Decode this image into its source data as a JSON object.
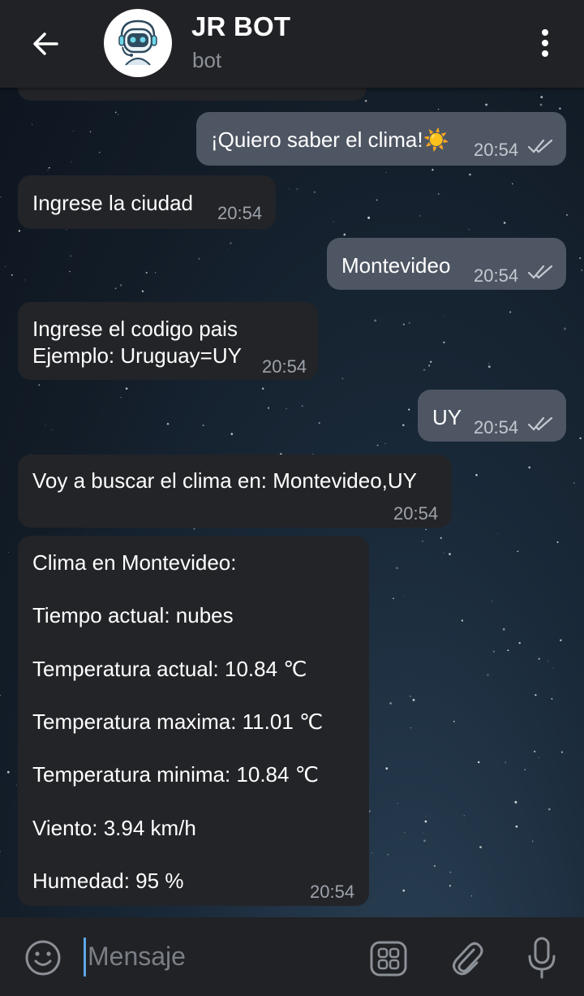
{
  "header": {
    "title": "JR BOT",
    "subtitle": "bot"
  },
  "messages": [
    {
      "id": "m1",
      "side": "out",
      "text": "¡Quiero saber el clima!☀️",
      "time": "20:54",
      "read": true
    },
    {
      "id": "m2",
      "side": "in",
      "text": "Ingrese la ciudad",
      "time": "20:54"
    },
    {
      "id": "m3",
      "side": "out",
      "text": "Montevideo",
      "time": "20:54",
      "read": true
    },
    {
      "id": "m4",
      "side": "in",
      "lines": [
        "Ingrese el codigo pais",
        "Ejemplo: Uruguay=UY"
      ],
      "time": "20:54"
    },
    {
      "id": "m5",
      "side": "out",
      "text": "UY",
      "time": "20:54",
      "read": true
    },
    {
      "id": "m6",
      "side": "in",
      "text": "Voy a buscar el clima en: Montevideo,UY",
      "time": "20:54"
    },
    {
      "id": "m7",
      "side": "in",
      "lines": [
        "Clima en Montevideo:",
        "Tiempo actual: nubes",
        "Temperatura actual: 10.84 ℃",
        "Temperatura maxima: 11.01 ℃",
        "Temperatura minima: 10.84 ℃",
        "Viento: 3.94 km/h",
        "Humedad: 95 %"
      ],
      "time": "20:54"
    }
  ],
  "input": {
    "placeholder": "Mensaje"
  },
  "icons": {
    "back": "arrow-left-icon",
    "menu": "more-vertical-icon",
    "emoji": "smiley-icon",
    "keyboard": "bot-keyboard-icon",
    "attach": "paperclip-icon",
    "mic": "microphone-icon"
  },
  "colors": {
    "header_bg": "#212226",
    "bubble_out": "#4e5663",
    "bubble_in": "#232428",
    "accent": "#5ea6e8"
  }
}
